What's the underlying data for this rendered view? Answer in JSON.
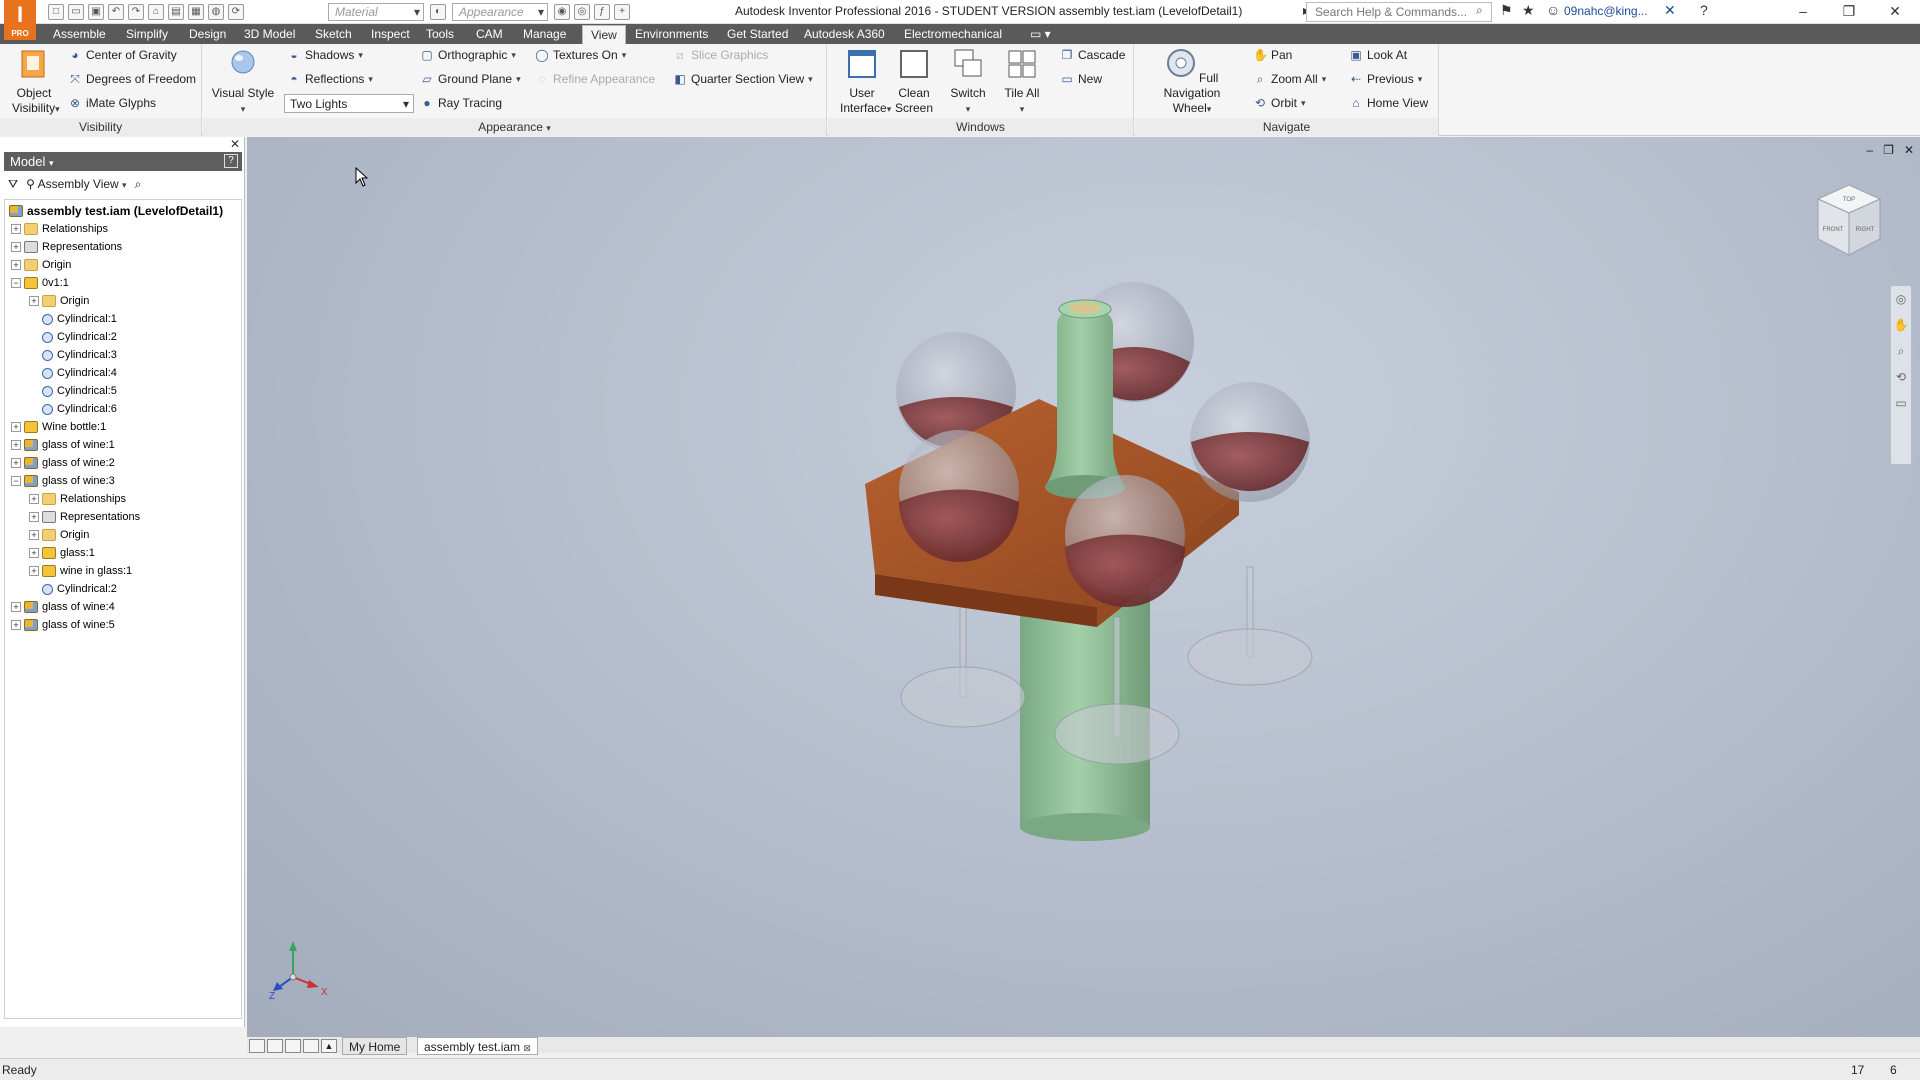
{
  "titlebar": {
    "material_placeholder": "Material",
    "appearance_placeholder": "Appearance",
    "title": "Autodesk Inventor Professional 2016 - STUDENT VERSION    assembly test.iam (LevelofDetail1)",
    "search_placeholder": "Search Help & Commands...",
    "user": "09nahc@king...",
    "logo_text": "I",
    "logo_sub": "PRO"
  },
  "ribbon_tabs": [
    "Assemble",
    "Simplify",
    "Design",
    "3D Model",
    "Sketch",
    "Inspect",
    "Tools",
    "CAM",
    "Manage",
    "View",
    "Environments",
    "Get Started",
    "Autodesk A360",
    "Electromechanical"
  ],
  "active_tab": "View",
  "ribbon": {
    "visibility": {
      "title": "Visibility",
      "object_visibility": "Object Visibility",
      "center_of_gravity": "Center of Gravity",
      "degrees_of_freedom": "Degrees of Freedom",
      "imate_glyphs": "iMate Glyphs"
    },
    "appearance": {
      "title": "Appearance",
      "visual_style": "Visual Style",
      "shadows": "Shadows",
      "reflections": "Reflections",
      "lighting": "Two Lights",
      "orthographic": "Orthographic",
      "ground_plane": "Ground Plane",
      "ray_tracing": "Ray Tracing",
      "textures_on": "Textures On",
      "refine_appearance": "Refine Appearance",
      "slice_graphics": "Slice Graphics",
      "quarter_section_view": "Quarter Section View"
    },
    "windows": {
      "title": "Windows",
      "user_interface": "User Interface",
      "clean_screen": "Clean Screen",
      "switch": "Switch",
      "tile_all": "Tile All",
      "cascade": "Cascade",
      "new": "New"
    },
    "navigate": {
      "title": "Navigate",
      "full_navigation_wheel": "Full Navigation Wheel",
      "pan": "Pan",
      "zoom_all": "Zoom All",
      "orbit": "Orbit",
      "look_at": "Look At",
      "previous": "Previous",
      "home_view": "Home View"
    }
  },
  "browser": {
    "title": "Model",
    "view_mode": "Assembly View",
    "tree": [
      {
        "label": "assembly test.iam (LevelofDetail1)",
        "icon": "asm",
        "depth": 0,
        "expand": "none"
      },
      {
        "label": "Relationships",
        "icon": "folder",
        "depth": 1,
        "expand": "plus"
      },
      {
        "label": "Representations",
        "icon": "rep",
        "depth": 1,
        "expand": "plus"
      },
      {
        "label": "Origin",
        "icon": "folder",
        "depth": 1,
        "expand": "plus"
      },
      {
        "label": "0v1:1",
        "icon": "part",
        "depth": 1,
        "expand": "minus"
      },
      {
        "label": "Origin",
        "icon": "folder",
        "depth": 2,
        "expand": "plus"
      },
      {
        "label": "Cylindrical:1",
        "icon": "joint",
        "depth": 2,
        "expand": "none"
      },
      {
        "label": "Cylindrical:2",
        "icon": "joint",
        "depth": 2,
        "expand": "none"
      },
      {
        "label": "Cylindrical:3",
        "icon": "joint",
        "depth": 2,
        "expand": "none"
      },
      {
        "label": "Cylindrical:4",
        "icon": "joint",
        "depth": 2,
        "expand": "none"
      },
      {
        "label": "Cylindrical:5",
        "icon": "joint",
        "depth": 2,
        "expand": "none"
      },
      {
        "label": "Cylindrical:6",
        "icon": "joint",
        "depth": 2,
        "expand": "none"
      },
      {
        "label": "Wine bottle:1",
        "icon": "part",
        "depth": 1,
        "expand": "plus"
      },
      {
        "label": "glass of wine:1",
        "icon": "asm",
        "depth": 1,
        "expand": "plus"
      },
      {
        "label": "glass of wine:2",
        "icon": "asm",
        "depth": 1,
        "expand": "plus"
      },
      {
        "label": "glass of wine:3",
        "icon": "asm",
        "depth": 1,
        "expand": "minus"
      },
      {
        "label": "Relationships",
        "icon": "folder",
        "depth": 2,
        "expand": "plus"
      },
      {
        "label": "Representations",
        "icon": "rep",
        "depth": 2,
        "expand": "plus"
      },
      {
        "label": "Origin",
        "icon": "folder",
        "depth": 2,
        "expand": "plus"
      },
      {
        "label": "glass:1",
        "icon": "part",
        "depth": 2,
        "expand": "plus"
      },
      {
        "label": "wine in glass:1",
        "icon": "part",
        "depth": 2,
        "expand": "plus"
      },
      {
        "label": "Cylindrical:2",
        "icon": "joint",
        "depth": 2,
        "expand": "none"
      },
      {
        "label": "glass of wine:4",
        "icon": "asm",
        "depth": 1,
        "expand": "plus"
      },
      {
        "label": "glass of wine:5",
        "icon": "asm",
        "depth": 1,
        "expand": "plus"
      }
    ]
  },
  "viewcube": {
    "top": "TOP",
    "front": "FRONT",
    "right": "RIGHT"
  },
  "triad": {
    "x": "X",
    "z": "Z"
  },
  "doc_tabs": {
    "home": "My Home",
    "active": "assembly test.iam"
  },
  "status": {
    "text": "Ready",
    "occurrences": "17",
    "files": "6"
  },
  "colors": {
    "accent": "#e8731c",
    "tab_bar": "#5a5a5a",
    "bottle": "#8fbf94",
    "tray": "#a5532a",
    "wine": "#7a2e30"
  }
}
